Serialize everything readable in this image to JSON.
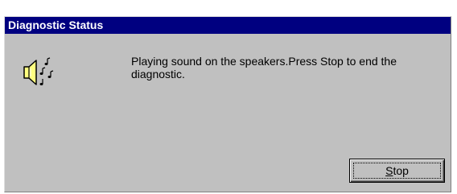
{
  "window": {
    "title": "Diagnostic Status"
  },
  "icon": {
    "name": "speaker-with-notes-icon"
  },
  "message": {
    "text": "Playing sound on the speakers.Press Stop to end the diagnostic."
  },
  "stop_button": {
    "mnemonic": "S",
    "label_rest": "top"
  },
  "colors": {
    "title_bar": "#000080",
    "title_text": "#ffffff",
    "dialog_face": "#c0c0c0",
    "speaker_fill": "#ffff80"
  }
}
